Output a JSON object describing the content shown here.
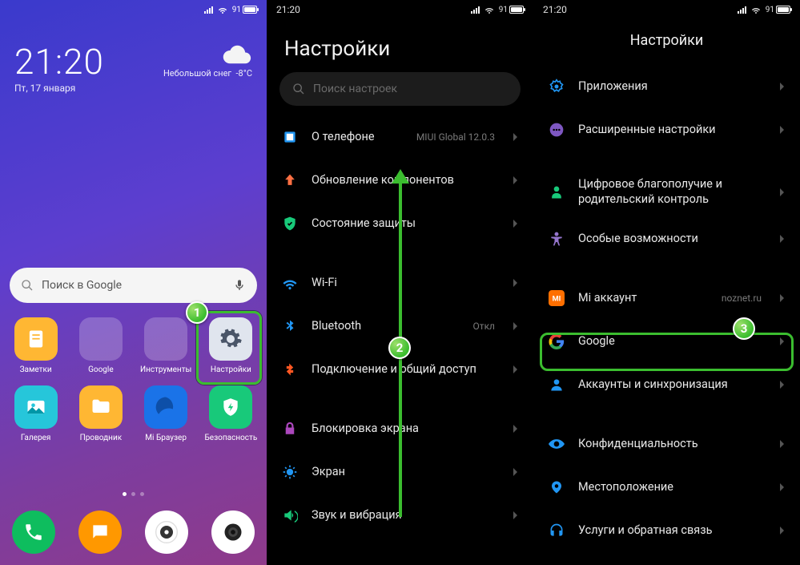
{
  "status": {
    "time": "21:20",
    "battery": "91"
  },
  "home": {
    "time": "21:20",
    "date": "Пт, 17 января",
    "weather_desc": "Небольшой снег",
    "weather_temp": "-8°C",
    "search_placeholder": "Поиск в Google",
    "apps": [
      {
        "name": "Заметки"
      },
      {
        "name": "Google"
      },
      {
        "name": "Инструменты"
      },
      {
        "name": "Настройки"
      },
      {
        "name": "Галерея"
      },
      {
        "name": "Проводник"
      },
      {
        "name": "Mi Браузер"
      },
      {
        "name": "Безопасность"
      }
    ]
  },
  "settings2": {
    "title": "Настройки",
    "search_placeholder": "Поиск настроек",
    "items": {
      "about": {
        "label": "О телефоне",
        "sub": "MIUI Global 12.0.3"
      },
      "update": {
        "label": "Обновление компонентов"
      },
      "security": {
        "label": "Состояние защиты"
      },
      "wifi": {
        "label": "Wi-Fi",
        "sub": ""
      },
      "bt": {
        "label": "Bluetooth",
        "sub": "Откл"
      },
      "share": {
        "label": "Подключение и общий доступ"
      },
      "lock": {
        "label": "Блокировка экрана"
      },
      "display": {
        "label": "Экран"
      },
      "sound": {
        "label": "Звук и вибрация"
      }
    }
  },
  "settings3": {
    "title": "Настройки",
    "items": {
      "apps": {
        "label": "Приложения"
      },
      "advanced": {
        "label": "Расширенные настройки"
      },
      "wellbeing": {
        "label": "Цифровое благополучие и родительский контроль"
      },
      "accessibility": {
        "label": "Особые возможности"
      },
      "mi": {
        "label": "Mi аккаунт",
        "sub": "noznet.ru"
      },
      "google": {
        "label": "Google"
      },
      "accounts": {
        "label": "Аккаунты и синхронизация"
      },
      "privacy": {
        "label": "Конфиденциальность"
      },
      "location": {
        "label": "Местоположение"
      },
      "feedback": {
        "label": "Услуги и обратная связь"
      }
    }
  },
  "annotations": {
    "b1": "1",
    "b2": "2",
    "b3": "3"
  }
}
